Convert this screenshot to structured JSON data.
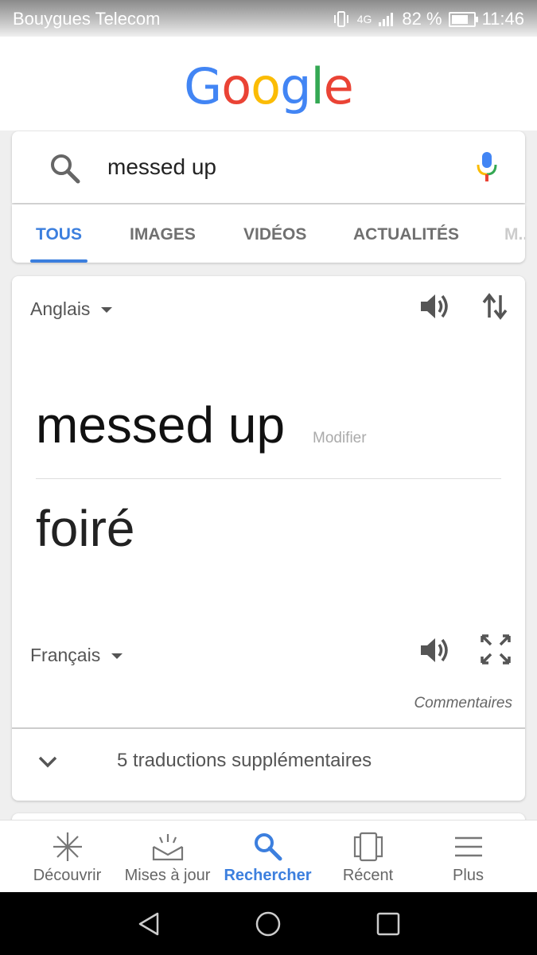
{
  "status_bar": {
    "carrier": "Bouygues Telecom",
    "network": "4G",
    "battery": "82 %",
    "time": "11:46"
  },
  "logo": {
    "letters": [
      "G",
      "o",
      "o",
      "g",
      "l",
      "e"
    ],
    "colors": [
      "#4285F4",
      "#EA4335",
      "#FBBC05",
      "#4285F4",
      "#34A853",
      "#EA4335"
    ]
  },
  "search": {
    "query": "messed up"
  },
  "tabs": [
    {
      "label": "TOUS",
      "active": true
    },
    {
      "label": "IMAGES"
    },
    {
      "label": "VIDÉOS"
    },
    {
      "label": "ACTUALITÉS"
    },
    {
      "label": "M..."
    }
  ],
  "translate": {
    "source_lang": "Anglais",
    "source_text": "messed up",
    "modify_label": "Modifier",
    "target_text": "foiré",
    "target_lang": "Français",
    "feedback_label": "Commentaires",
    "more_label": "5 traductions supplémentaires"
  },
  "bottom_nav": [
    {
      "label": "Découvrir",
      "icon": "sparkle-icon"
    },
    {
      "label": "Mises à jour",
      "icon": "updates-icon"
    },
    {
      "label": "Rechercher",
      "icon": "search-icon",
      "active": true
    },
    {
      "label": "Récent",
      "icon": "recent-icon"
    },
    {
      "label": "Plus",
      "icon": "menu-icon"
    }
  ],
  "colors": {
    "accent": "#3c7fde",
    "text_muted": "#707070"
  }
}
